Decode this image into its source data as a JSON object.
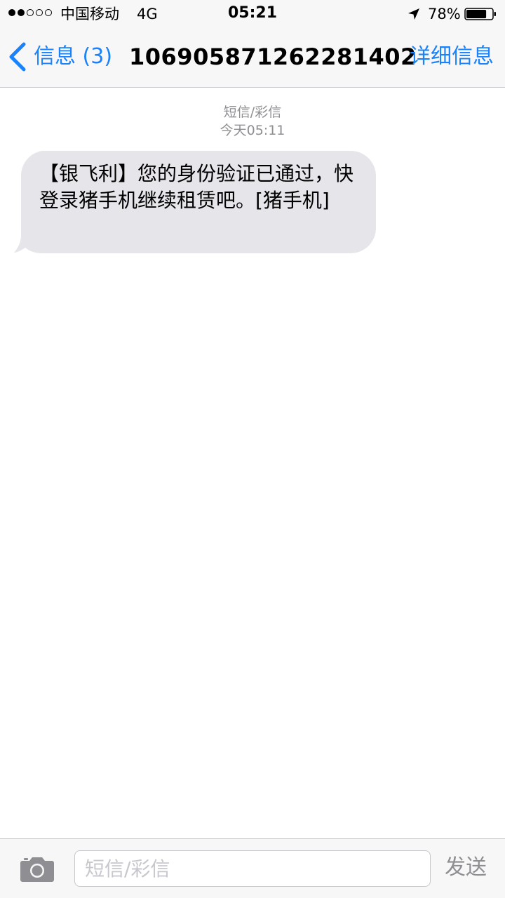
{
  "status_bar": {
    "signal_strength_filled": 2,
    "signal_strength_total": 5,
    "carrier": "中国移动",
    "network": "4G",
    "time": "05:21",
    "location_icon": "location-arrow-icon",
    "battery_percent": "78%",
    "battery_level": 0.78
  },
  "nav": {
    "back_label": "信息 (3)",
    "title": "106905871262281402",
    "details_label": "详细信息"
  },
  "conversation": {
    "message_kind": "短信/彩信",
    "timestamp": "今天05:11",
    "messages": [
      {
        "direction": "incoming",
        "text": "【银飞利】您的身份验证已通过，快登录猪手机继续租赁吧。[猪手机]"
      }
    ]
  },
  "input_bar": {
    "camera_icon": "camera-icon",
    "placeholder": "短信/彩信",
    "value": "",
    "send_label": "发送"
  },
  "colors": {
    "accent": "#1a82fb",
    "bubble_incoming": "#e5e5ea",
    "bar_background": "#f7f7f7",
    "meta_text": "#8e8e93"
  }
}
